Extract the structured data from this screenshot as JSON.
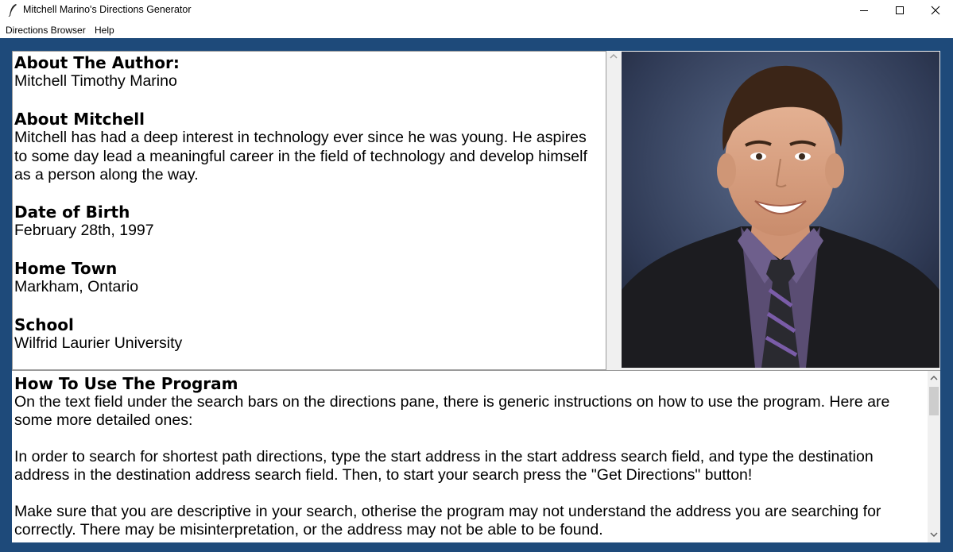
{
  "window": {
    "title": "Mitchell Marino's Directions Generator",
    "minimize_icon": "minimize-icon",
    "maximize_icon": "maximize-icon",
    "close_icon": "close-icon",
    "app_icon": "feather-icon"
  },
  "menu": {
    "items": [
      "Directions Browser",
      "Help"
    ]
  },
  "bio": {
    "sections": [
      {
        "heading": "About The Author:",
        "text": "Mitchell Timothy Marino"
      },
      {
        "heading": "About Mitchell",
        "text": "Mitchell has had a deep interest in technology ever since he was young. He aspires to some day lead a meaningful career in the field of technology and develop himself as a person along the way."
      },
      {
        "heading": "Date of Birth",
        "text": "February 28th, 1997"
      },
      {
        "heading": "Home Town",
        "text": "Markham, Ontario"
      },
      {
        "heading": "School",
        "text": "Wilfrid Laurier University"
      }
    ]
  },
  "help": {
    "heading": "How To Use The Program",
    "paragraphs": [
      "On the text field under the search bars on the directions pane, there is generic instructions on how to use the program. Here are some more detailed ones:",
      "In order to search for shortest path directions, type the start address in the start address search field, and type the destination address in the destination address search field. Then, to start your search press the \"Get Directions\" button!",
      "Make sure that you are descriptive in your search, otherise the program may not understand the address you are searching for correctly. There may be misinterpretation, or the address may not be able to be found."
    ]
  },
  "colors": {
    "frame": "#1e4a7a",
    "pane": "#ffffff",
    "scrollbar": "#f0f0f0"
  }
}
